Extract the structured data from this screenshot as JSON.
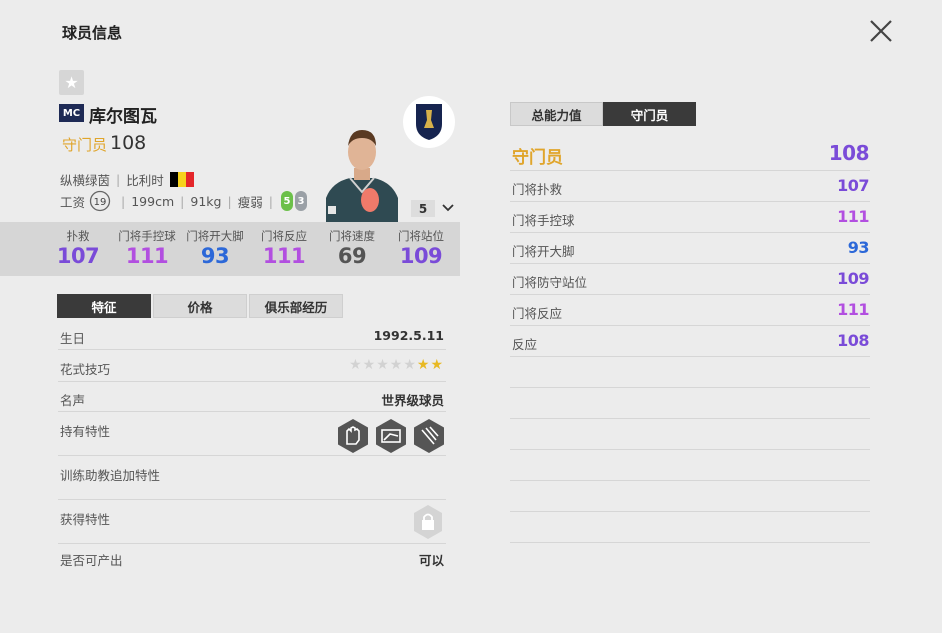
{
  "page": {
    "title": "球员信息"
  },
  "player": {
    "season_badge": "MC",
    "name": "库尔图瓦",
    "position": "守门员",
    "ovr": "108",
    "foot_label": "纵横绿茵",
    "nationality": "比利时",
    "wage_label": "工资",
    "wage": "19",
    "height": "199cm",
    "weight": "91kg",
    "body_type": "瘦弱",
    "weak_foot": "5",
    "skill_moves": "3",
    "level": "5",
    "flag_colors": [
      "#000000",
      "#f6d21d",
      "#e4262a"
    ]
  },
  "stats": [
    {
      "label": "扑救",
      "value": "107",
      "color": "#7a4bd8"
    },
    {
      "label": "门将手控球",
      "value": "111",
      "color": "#b24fe0"
    },
    {
      "label": "门将开大脚",
      "value": "93",
      "color": "#2c68d8"
    },
    {
      "label": "门将反应",
      "value": "111",
      "color": "#b24fe0"
    },
    {
      "label": "门将速度",
      "value": "69",
      "color": "#555555"
    },
    {
      "label": "门将站位",
      "value": "109",
      "color": "#7a4bd8"
    }
  ],
  "tabs": [
    "特征",
    "价格",
    "俱乐部经历"
  ],
  "attributes": {
    "birthday_label": "生日",
    "birthday": "1992.5.11",
    "skill_label": "花式技巧",
    "skill_stars": 2,
    "skill_stars_max": 7,
    "fame_label": "名声",
    "fame": "世界级球员",
    "traits_label": "持有特性",
    "trainer_label": "训练助教追加特性",
    "acquired_label": "获得特性",
    "producible_label": "是否可产出",
    "producible": "可以"
  },
  "right_tabs": [
    "总能力值",
    "守门员"
  ],
  "detail": {
    "head_label": "守门员",
    "head_value": "108",
    "rows": [
      {
        "label": "门将扑救",
        "value": "107",
        "color": "#7a4bd8"
      },
      {
        "label": "门将手控球",
        "value": "111",
        "color": "#b24fe0"
      },
      {
        "label": "门将开大脚",
        "value": "93",
        "color": "#2c68d8"
      },
      {
        "label": "门将防守站位",
        "value": "109",
        "color": "#7a4bd8"
      },
      {
        "label": "门将反应",
        "value": "111",
        "color": "#b24fe0"
      },
      {
        "label": "反应",
        "value": "108",
        "color": "#7a4bd8"
      }
    ]
  },
  "colors": {
    "accent_gold": "#e0a52b",
    "tab_active": "#3a3a3a",
    "weak_foot_green": "#6cc04a",
    "skill_grey": "#9aa0a6"
  }
}
